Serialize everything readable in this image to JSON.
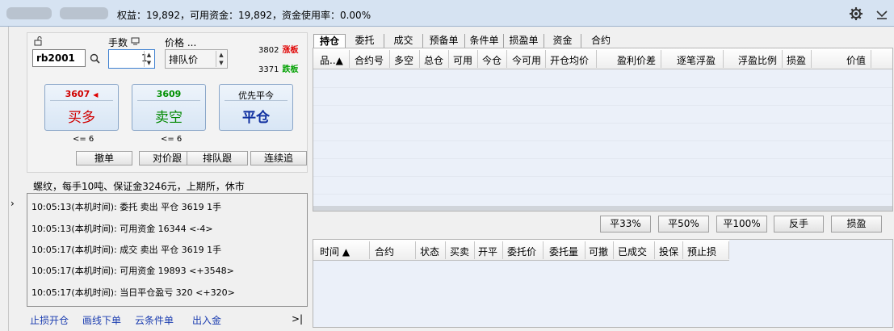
{
  "titlebar": {
    "summary": "权益：19,892，可用资金：19,892，资金使用率：0.00%"
  },
  "order": {
    "qty_label": "手数",
    "price_label": "价格 ...",
    "contract": "rb2001",
    "qty": "1",
    "price_type": "排队价",
    "limit_up_price": "3802",
    "limit_up_tag": "涨板",
    "limit_down_price": "3371",
    "limit_down_tag": "跌板",
    "buttons": [
      {
        "price": "3607",
        "label": "买多",
        "limit": "<= 6"
      },
      {
        "price": "3609",
        "label": "卖空",
        "limit": "<= 6"
      },
      {
        "price": "优先平今",
        "label": "平仓"
      }
    ],
    "small_buttons": [
      "撤单",
      "对价跟",
      "排队跟",
      "连续追"
    ]
  },
  "info_line": "螺纹，每手10吨、保证金3246元，上期所，休市",
  "log": [
    "10:05:13(本机时间): 委托  卖出  平仓  3619  1手",
    "10:05:13(本机时间): 可用资金 16344  <-4>",
    "10:05:17(本机时间): 成交  卖出  平仓  3619  1手",
    "10:05:17(本机时间): 可用资金 19893  <+3548>",
    "10:05:17(本机时间): 当日平仓盈亏 320  <+320>"
  ],
  "bottom_links": [
    "止损开仓",
    "画线下单",
    "云条件单",
    "出入金"
  ],
  "tabs": [
    "持仓",
    "委托",
    "成交",
    "预备单",
    "条件单",
    "损盈单",
    "资金",
    "合约"
  ],
  "positions_header": [
    "品..▲",
    "合约号",
    "多空",
    "总仓",
    "可用",
    "今仓",
    "今可用",
    "开仓均价",
    "盈利价差",
    "逐笔浮盈",
    "浮盈比例",
    "损盈",
    "价值"
  ],
  "action_buttons": [
    "平33%",
    "平50%",
    "平100%",
    "反手",
    "损盈"
  ],
  "orders_header": [
    "时间 ▲",
    "合约",
    "状态",
    "买卖",
    "开平",
    "委托价",
    "委托量",
    "可撤",
    "已成交",
    "投保",
    "预止损"
  ]
}
